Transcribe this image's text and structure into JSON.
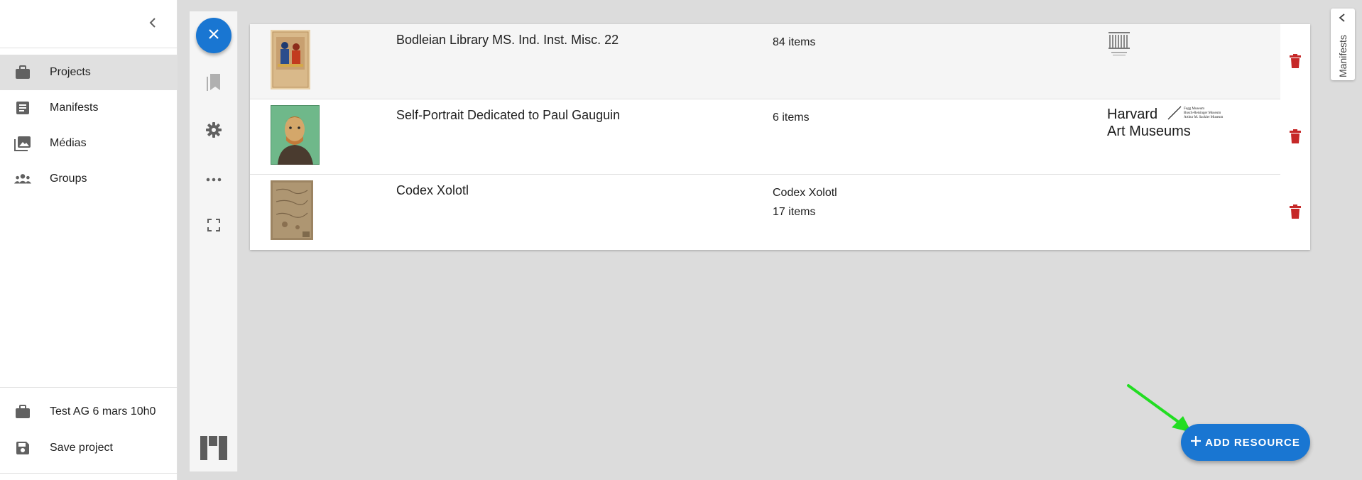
{
  "sidebar": {
    "nav": [
      {
        "label": "Projects",
        "icon": "briefcase-icon",
        "active": true
      },
      {
        "label": "Manifests",
        "icon": "document-icon"
      },
      {
        "label": "Médias",
        "icon": "photo-library-icon"
      },
      {
        "label": "Groups",
        "icon": "groups-icon"
      }
    ],
    "footer": [
      {
        "label": "Test AG 6 mars 10h0",
        "icon": "briefcase-icon"
      },
      {
        "label": "Save project",
        "icon": "save-icon"
      }
    ]
  },
  "rail": {
    "buttons": [
      "close-icon",
      "bookmark-icon",
      "gear-icon",
      "more-horizontal-icon",
      "fullscreen-icon",
      "mosaic-layout-icon"
    ]
  },
  "resources": {
    "rows": [
      {
        "title": "Bodleian Library MS. Ind. Inst. Misc. 22",
        "meta_line1": "84 items",
        "meta_line2": "",
        "logo_text": "BODLEIAN LIBRARIES",
        "highlight": true
      },
      {
        "title": "Self-Portrait Dedicated to Paul Gauguin",
        "meta_line1": "6 items",
        "meta_line2": "",
        "logo": {
          "line1": "Harvard",
          "line2": "Art Museums",
          "small": [
            "Fogg Museum",
            "Busch-Reisinger Museum",
            "Arthur M. Sackler Museum"
          ]
        }
      },
      {
        "title": "Codex Xolotl",
        "meta_line1": "Codex Xolotl",
        "meta_line2": "17 items"
      }
    ]
  },
  "manifests_panel": {
    "label": "Manifests"
  },
  "add_resource": {
    "label": "ADD RESOURCE"
  },
  "colors": {
    "primary": "#1976d2",
    "delete": "#c62828",
    "arrow": "#22dd22"
  }
}
